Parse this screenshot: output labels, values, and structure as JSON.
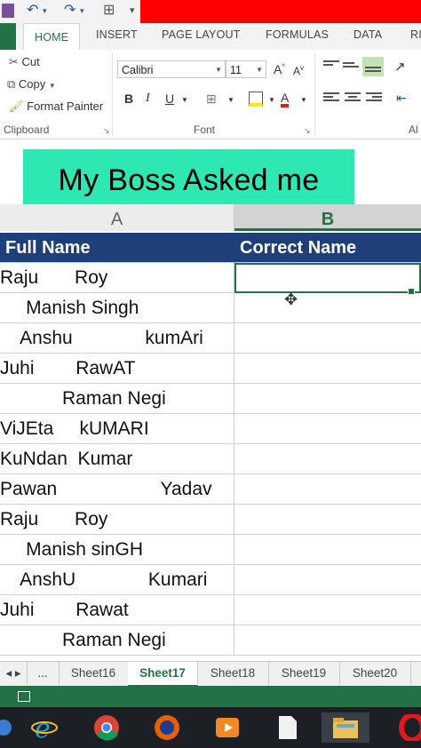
{
  "ribbon_tabs": [
    "HOME",
    "INSERT",
    "PAGE LAYOUT",
    "FORMULAS",
    "DATA",
    "RI"
  ],
  "clipboard": {
    "cut": "Cut",
    "copy": "Copy",
    "format_painter": "Format Painter",
    "group_label": "Clipboard"
  },
  "font_group": {
    "font_name": "Calibri",
    "font_size": "11",
    "bold": "B",
    "italic": "I",
    "underline": "U",
    "font_color": "A",
    "grow": "A",
    "shrink": "A",
    "group_label": "Font"
  },
  "alignment_group": {
    "group_label": "Al"
  },
  "banner": "My Boss Asked me",
  "columns": {
    "a": "A",
    "b": "B"
  },
  "table": {
    "headers": [
      "Full Name",
      "Correct Name"
    ],
    "rows": [
      "Raju       Roy",
      "     Manish Singh",
      "    Anshu              kumAri",
      "Juhi        RawAT",
      "            Raman Negi",
      "ViJEta     kUMARI",
      "KuNdan  Kumar",
      "Pawan                    Yadav",
      "Raju       Roy",
      "     Manish sinGH",
      "    AnshU              Kumari",
      "Juhi        Rawat",
      "            Raman Negi"
    ]
  },
  "sheet_tabs": {
    "more": "...",
    "tabs": [
      "Sheet16",
      "Sheet17",
      "Sheet18",
      "Sheet19",
      "Sheet20"
    ],
    "active": "Sheet17"
  },
  "colors": {
    "excel_green": "#217346",
    "header_fill": "#1f3f7a",
    "banner_fill": "#2ee8b4",
    "title_bar": "#ff0000"
  }
}
